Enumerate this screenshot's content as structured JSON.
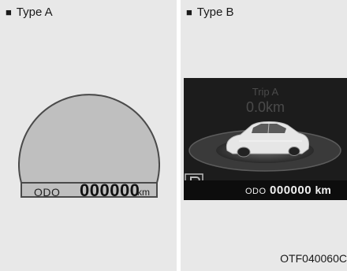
{
  "panels": {
    "type_a": {
      "bullet": "■",
      "heading": "Type A",
      "odo_label": "ODO",
      "odo_value": "000000",
      "odo_unit": "km"
    },
    "type_b": {
      "bullet": "■",
      "heading": "Type B",
      "trip_label": "Trip A",
      "trip_value": "0.0km",
      "odo_label": "ODO",
      "odo_value": "000000",
      "odo_unit": "km"
    }
  },
  "figure_id": "OTF040060C",
  "icons": [
    "gauge-dial-icon",
    "car-icon",
    "parking-p-icon"
  ]
}
